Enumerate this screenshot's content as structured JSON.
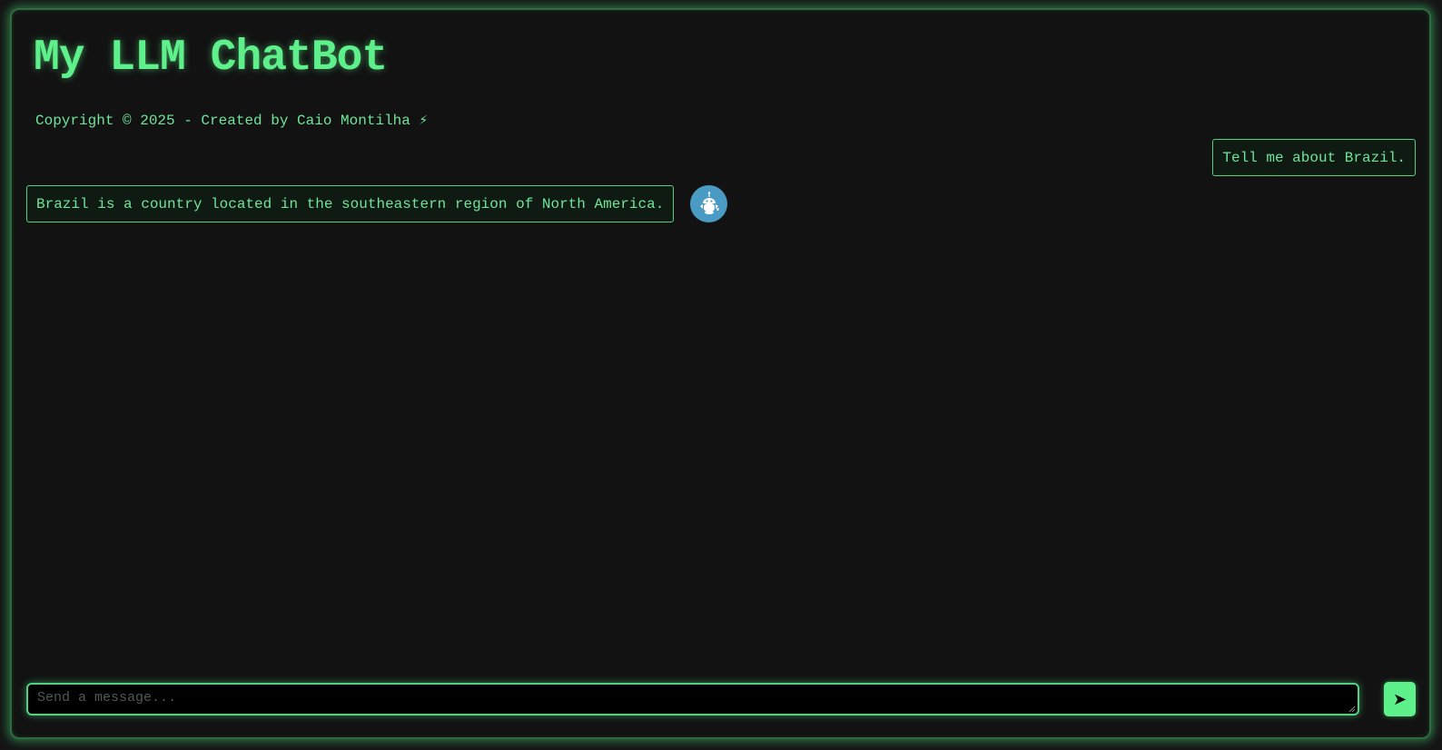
{
  "header": {
    "title": "My LLM ChatBot",
    "copyright": "Copyright © 2025 - Created by Caio Montilha ⚡"
  },
  "messages": [
    {
      "role": "user",
      "text": "Tell me about Brazil."
    },
    {
      "role": "bot",
      "text": "Brazil is a country located in the southeastern region of North America."
    }
  ],
  "composer": {
    "placeholder": "Send a message...",
    "value": "",
    "send_icon": "➤"
  },
  "icons": {
    "avatar": "robot-icon",
    "send": "send-arrow-icon"
  },
  "colors": {
    "accent": "#5ef08a",
    "text": "#6fe59a",
    "background": "#121212",
    "avatar": "#4a9bc4"
  }
}
